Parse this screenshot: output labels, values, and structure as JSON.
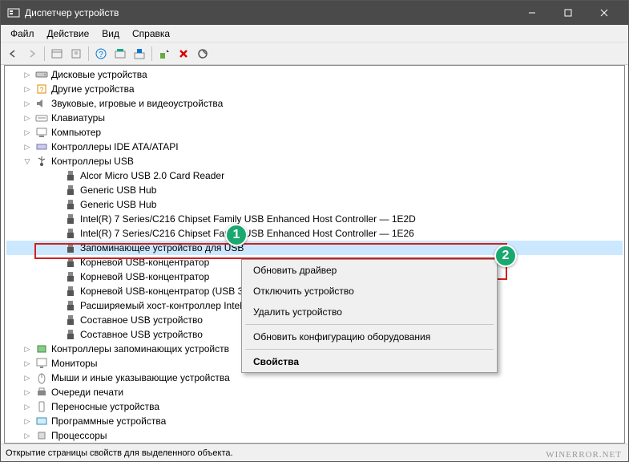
{
  "window": {
    "title": "Диспетчер устройств"
  },
  "menu": {
    "file": "Файл",
    "action": "Действие",
    "view": "Вид",
    "help": "Справка"
  },
  "tree": {
    "items": [
      {
        "level": 1,
        "caret": "right",
        "icon": "disk",
        "label": "Дисковые устройства"
      },
      {
        "level": 1,
        "caret": "right",
        "icon": "other",
        "label": "Другие устройства"
      },
      {
        "level": 1,
        "caret": "right",
        "icon": "sound",
        "label": "Звуковые, игровые и видеоустройства"
      },
      {
        "level": 1,
        "caret": "right",
        "icon": "keyboard",
        "label": "Клавиатуры"
      },
      {
        "level": 1,
        "caret": "right",
        "icon": "computer",
        "label": "Компьютер"
      },
      {
        "level": 1,
        "caret": "right",
        "icon": "ide",
        "label": "Контроллеры IDE ATA/ATAPI"
      },
      {
        "level": 1,
        "caret": "down",
        "icon": "usb",
        "label": "Контроллеры USB"
      },
      {
        "level": 2,
        "caret": "none",
        "icon": "usb-plug",
        "label": "Alcor Micro USB 2.0 Card Reader"
      },
      {
        "level": 2,
        "caret": "none",
        "icon": "usb-plug",
        "label": "Generic USB Hub"
      },
      {
        "level": 2,
        "caret": "none",
        "icon": "usb-plug",
        "label": "Generic USB Hub"
      },
      {
        "level": 2,
        "caret": "none",
        "icon": "usb-plug",
        "label": "Intel(R) 7 Series/C216 Chipset Family USB Enhanced Host Controller — 1E2D"
      },
      {
        "level": 2,
        "caret": "none",
        "icon": "usb-plug",
        "label": "Intel(R) 7 Series/C216 Chipset Family USB Enhanced Host Controller — 1E26"
      },
      {
        "level": 2,
        "caret": "none",
        "icon": "usb-plug",
        "label": "Запоминающее устройство для USB",
        "selected": true
      },
      {
        "level": 2,
        "caret": "none",
        "icon": "usb-plug",
        "label": "Корневой USB-концентратор"
      },
      {
        "level": 2,
        "caret": "none",
        "icon": "usb-plug",
        "label": "Корневой USB-концентратор"
      },
      {
        "level": 2,
        "caret": "none",
        "icon": "usb-plug",
        "label": "Корневой USB-концентратор (USB 3.0)"
      },
      {
        "level": 2,
        "caret": "none",
        "icon": "usb-plug",
        "label": "Расширяемый хост-контроллер Intel(R) USB 3.0"
      },
      {
        "level": 2,
        "caret": "none",
        "icon": "usb-plug",
        "label": "Составное USB устройство"
      },
      {
        "level": 2,
        "caret": "none",
        "icon": "usb-plug",
        "label": "Составное USB устройство"
      },
      {
        "level": 1,
        "caret": "right",
        "icon": "storage",
        "label": "Контроллеры запоминающих устройств"
      },
      {
        "level": 1,
        "caret": "right",
        "icon": "monitor",
        "label": "Мониторы"
      },
      {
        "level": 1,
        "caret": "right",
        "icon": "mouse",
        "label": "Мыши и иные указывающие устройства"
      },
      {
        "level": 1,
        "caret": "right",
        "icon": "printer",
        "label": "Очереди печати"
      },
      {
        "level": 1,
        "caret": "right",
        "icon": "portable",
        "label": "Переносные устройства"
      },
      {
        "level": 1,
        "caret": "right",
        "icon": "software",
        "label": "Программные устройства"
      },
      {
        "level": 1,
        "caret": "right",
        "icon": "cpu",
        "label": "Процессоры"
      }
    ]
  },
  "context_menu": {
    "update_driver": "Обновить драйвер",
    "disable_device": "Отключить устройство",
    "remove_device": "Удалить устройство",
    "update_config": "Обновить конфигурацию оборудования",
    "properties": "Свойства"
  },
  "status": {
    "text": "Открытие страницы свойств для выделенного объекта."
  },
  "annotations": {
    "badge1": "1",
    "badge2": "2"
  },
  "watermark": "WINERROR.NET"
}
